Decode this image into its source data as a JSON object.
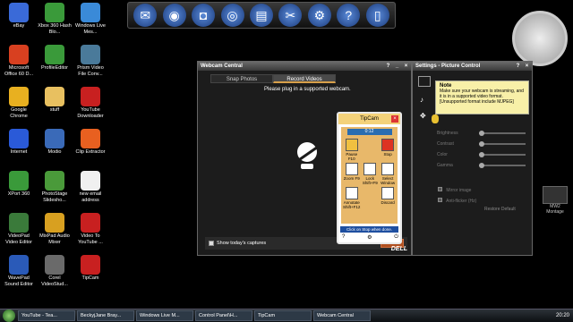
{
  "desktop_icons": [
    {
      "label": "eBay",
      "icon": "ebay-icon",
      "color": "#3a6ad8"
    },
    {
      "label": "Xbox 360 Hash Blo...",
      "icon": "xbox-icon",
      "color": "#3a9a3a"
    },
    {
      "label": "Windows Live Mes...",
      "icon": "messenger-icon",
      "color": "#3a8ad8"
    },
    {
      "label": "Microsoft Office 60 D...",
      "icon": "office-icon",
      "color": "#d84020"
    },
    {
      "label": "ProfileEditor",
      "icon": "xbox-icon",
      "color": "#3a9a3a"
    },
    {
      "label": "Prism Video File Conv...",
      "icon": "prism-icon",
      "color": "#4a7a9a"
    },
    {
      "label": "Google Chrome",
      "icon": "chrome-icon",
      "color": "#e8b020"
    },
    {
      "label": "stuff",
      "icon": "folder-icon",
      "color": "#e8c060"
    },
    {
      "label": "YouTube Downloader",
      "icon": "youtube-icon",
      "color": "#c82020"
    },
    {
      "label": "Internet",
      "icon": "internet-icon",
      "color": "#2a5ad8"
    },
    {
      "label": "Modio",
      "icon": "modio-icon",
      "color": "#3a6ab8"
    },
    {
      "label": "Clip Extractor",
      "icon": "gear-icon",
      "color": "#e86020"
    },
    {
      "label": "XPort 360",
      "icon": "xbox-icon",
      "color": "#3a9a3a"
    },
    {
      "label": "PhotoStage Slidesho...",
      "icon": "photostage-icon",
      "color": "#4a9a3a"
    },
    {
      "label": "new email address",
      "icon": "document-icon",
      "color": "#f0f0f0"
    },
    {
      "label": "VideoPad Video Editor",
      "icon": "videopad-icon",
      "color": "#3a7a3a"
    },
    {
      "label": "MixPad Audio Mixer",
      "icon": "mixpad-icon",
      "color": "#d8a020"
    },
    {
      "label": "Video To YouTube ...",
      "icon": "video-youtube-icon",
      "color": "#c82020"
    },
    {
      "label": "WavePad Sound Editor",
      "icon": "wavepad-icon",
      "color": "#2a5ab8"
    },
    {
      "label": "Corel VideoStud...",
      "icon": "corel-icon",
      "color": "#6a6a6a"
    },
    {
      "label": "TipCam",
      "icon": "tipcam-icon",
      "color": "#c82020"
    }
  ],
  "dock": [
    {
      "icon": "mail-icon",
      "glyph": "✉"
    },
    {
      "icon": "globe-icon",
      "glyph": "◉"
    },
    {
      "icon": "camera-icon",
      "glyph": "◘"
    },
    {
      "icon": "speaker-icon",
      "glyph": "◎"
    },
    {
      "icon": "film-icon",
      "glyph": "▤"
    },
    {
      "icon": "tools-icon",
      "glyph": "✂"
    },
    {
      "icon": "settings-icon",
      "glyph": "⚙"
    },
    {
      "icon": "help-icon",
      "glyph": "?"
    },
    {
      "icon": "trash-icon",
      "glyph": "▯"
    }
  ],
  "webcam_window": {
    "title": "Webcam Central",
    "tabs": [
      "Snap Photos",
      "Record Videos"
    ],
    "message": "Please plug in a supported webcam.",
    "checkbox_label": "Show today's captures",
    "brand": "DELL"
  },
  "tipcam": {
    "title": "TipCam",
    "timer": "0:12",
    "buttons": [
      {
        "label": "Pause F10",
        "icon": "pause-icon"
      },
      {
        "label": "",
        "icon": "blank-icon"
      },
      {
        "label": "Stop",
        "icon": "stop-icon"
      },
      {
        "label": "Zoom F9",
        "icon": "zoom-icon"
      },
      {
        "label": "Lock Shift+F9",
        "icon": "lock-icon"
      },
      {
        "label": "Select Window",
        "icon": "select-window-icon"
      },
      {
        "label": "Annotate Shift+F12",
        "icon": "annotate-icon"
      },
      {
        "label": "",
        "icon": "blank-icon"
      },
      {
        "label": "Discard",
        "icon": "discard-icon"
      }
    ],
    "status": "Click on Stop when done."
  },
  "settings": {
    "title": "Settings - Picture Control",
    "note_title": "Note",
    "note_text": "Make sure your webcam is streaming, and it is in a supported video format. [Unsupported format include MJPEG]",
    "sliders": [
      "Brightness",
      "Contrast",
      "Color",
      "Gamma"
    ],
    "options": [
      "Mirror image",
      "Anti-flicker (Hz)"
    ],
    "restore_label": "Restore Default"
  },
  "gadgets": {
    "misc_label": "MW2 Montage"
  },
  "taskbar": {
    "items": [
      "YouTube - Tea...",
      "BeckyjJane Bray...",
      "Windows Live M...",
      "Control Panel\\H...",
      "TipCam",
      "Webcam Central"
    ],
    "clock": "20:20"
  }
}
